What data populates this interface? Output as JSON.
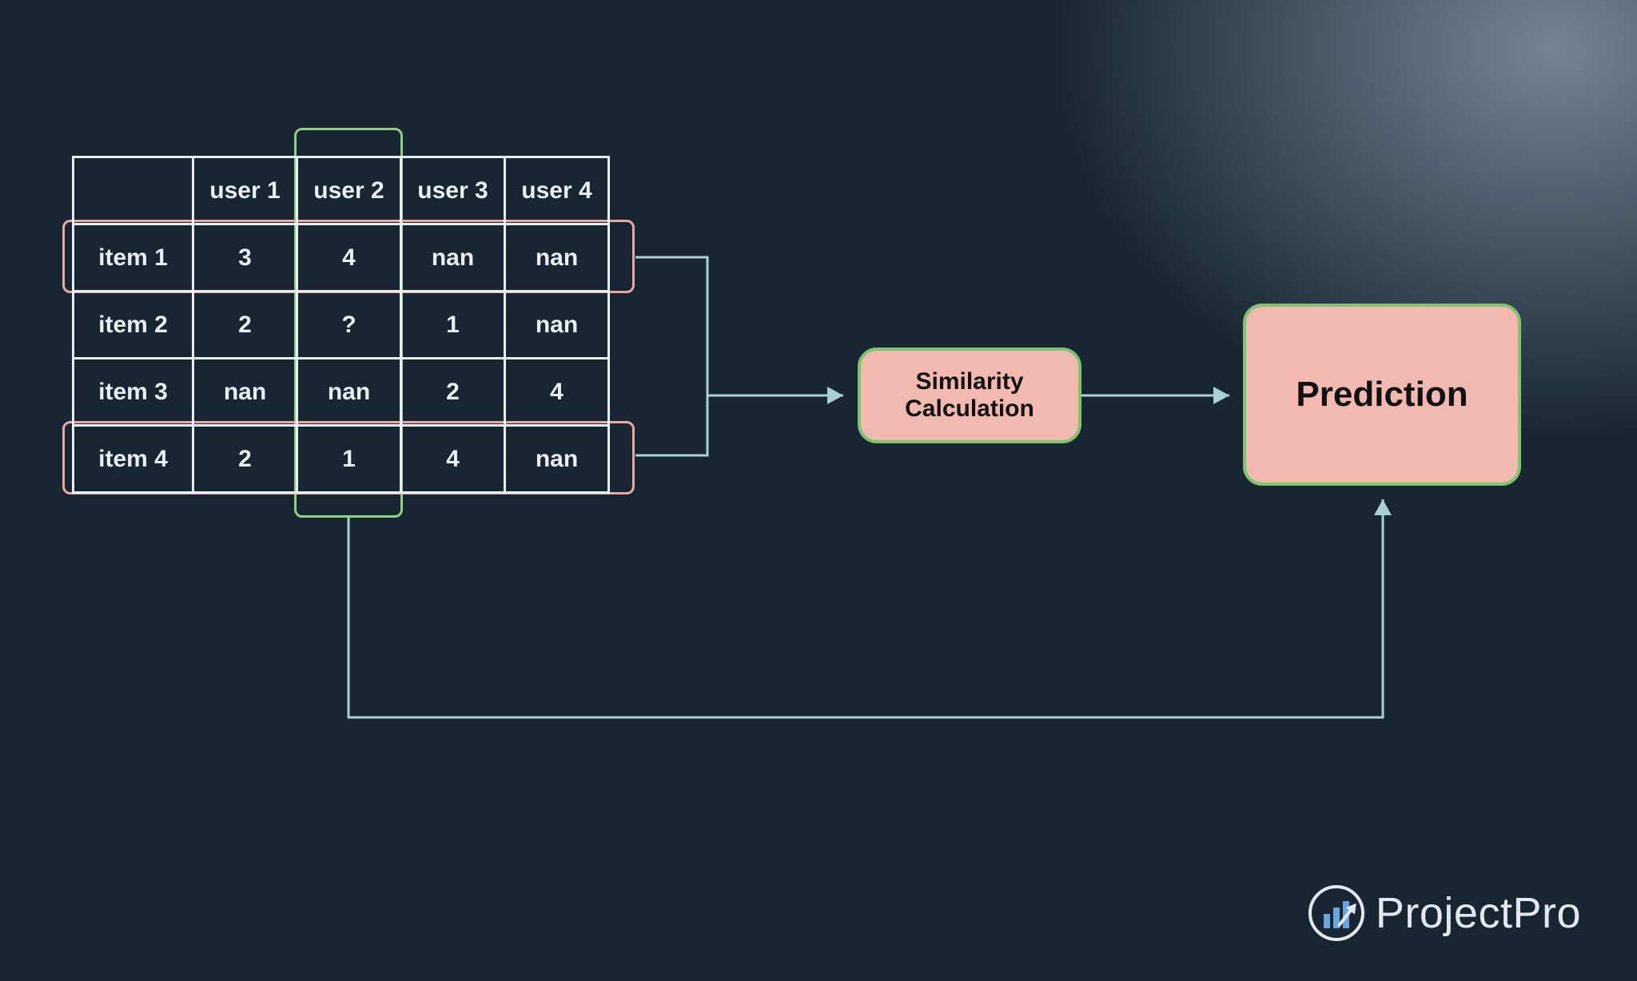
{
  "matrix": {
    "col_headers": [
      "",
      "user 1",
      "user 2",
      "user 3",
      "user 4"
    ],
    "rows": [
      {
        "label": "item 1",
        "cells": [
          "3",
          "4",
          "nan",
          "nan"
        ]
      },
      {
        "label": "item 2",
        "cells": [
          "2",
          "?",
          "1",
          "nan"
        ]
      },
      {
        "label": "item 3",
        "cells": [
          "nan",
          "nan",
          "2",
          "4"
        ]
      },
      {
        "label": "item 4",
        "cells": [
          "2",
          "1",
          "4",
          "nan"
        ]
      }
    ],
    "highlights": {
      "row_highlights": [
        "item 1",
        "item 4"
      ],
      "column_highlight": "user 2"
    }
  },
  "nodes": {
    "similarity": "Similarity Calculation",
    "prediction": "Prediction"
  },
  "flow": [
    "matrix.row.item_1 -> similarity",
    "matrix.row.item_4 -> similarity",
    "similarity -> prediction",
    "matrix.col.user_2 -> prediction"
  ],
  "branding": {
    "name": "ProjectPro"
  },
  "colors": {
    "background": "#182633",
    "table_border": "#e9eef2",
    "row_highlight": "#e9a9a2",
    "col_highlight": "#8fcf86",
    "node_fill": "#f1b9b0",
    "node_border": "#7fc46f",
    "arrow": "#a9d1d5"
  }
}
